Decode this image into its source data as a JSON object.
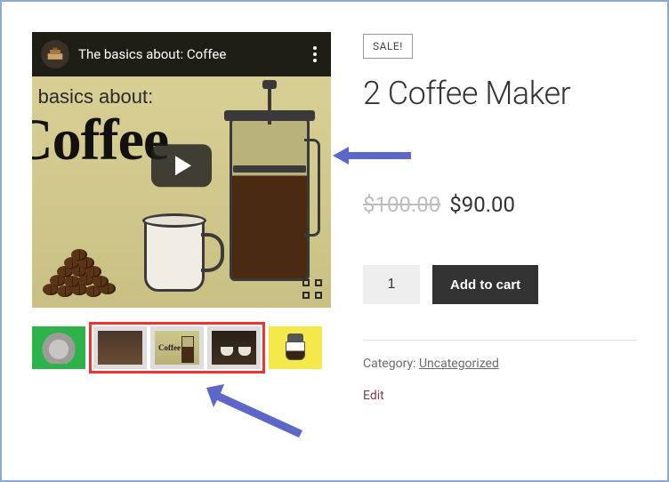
{
  "video": {
    "title": "The basics about: Coffee",
    "overlay_line1": "he basics about:",
    "overlay_line2": "Coffee"
  },
  "thumbnails": {
    "mini_label": "Coffee"
  },
  "product": {
    "sale_badge": "SALE!",
    "title": "2 Coffee Maker",
    "old_price": "$100.00",
    "price": "$90.00",
    "quantity": "1",
    "add_to_cart": "Add to cart",
    "category_label": "Category: ",
    "category_value": "Uncategorized",
    "edit": "Edit"
  }
}
